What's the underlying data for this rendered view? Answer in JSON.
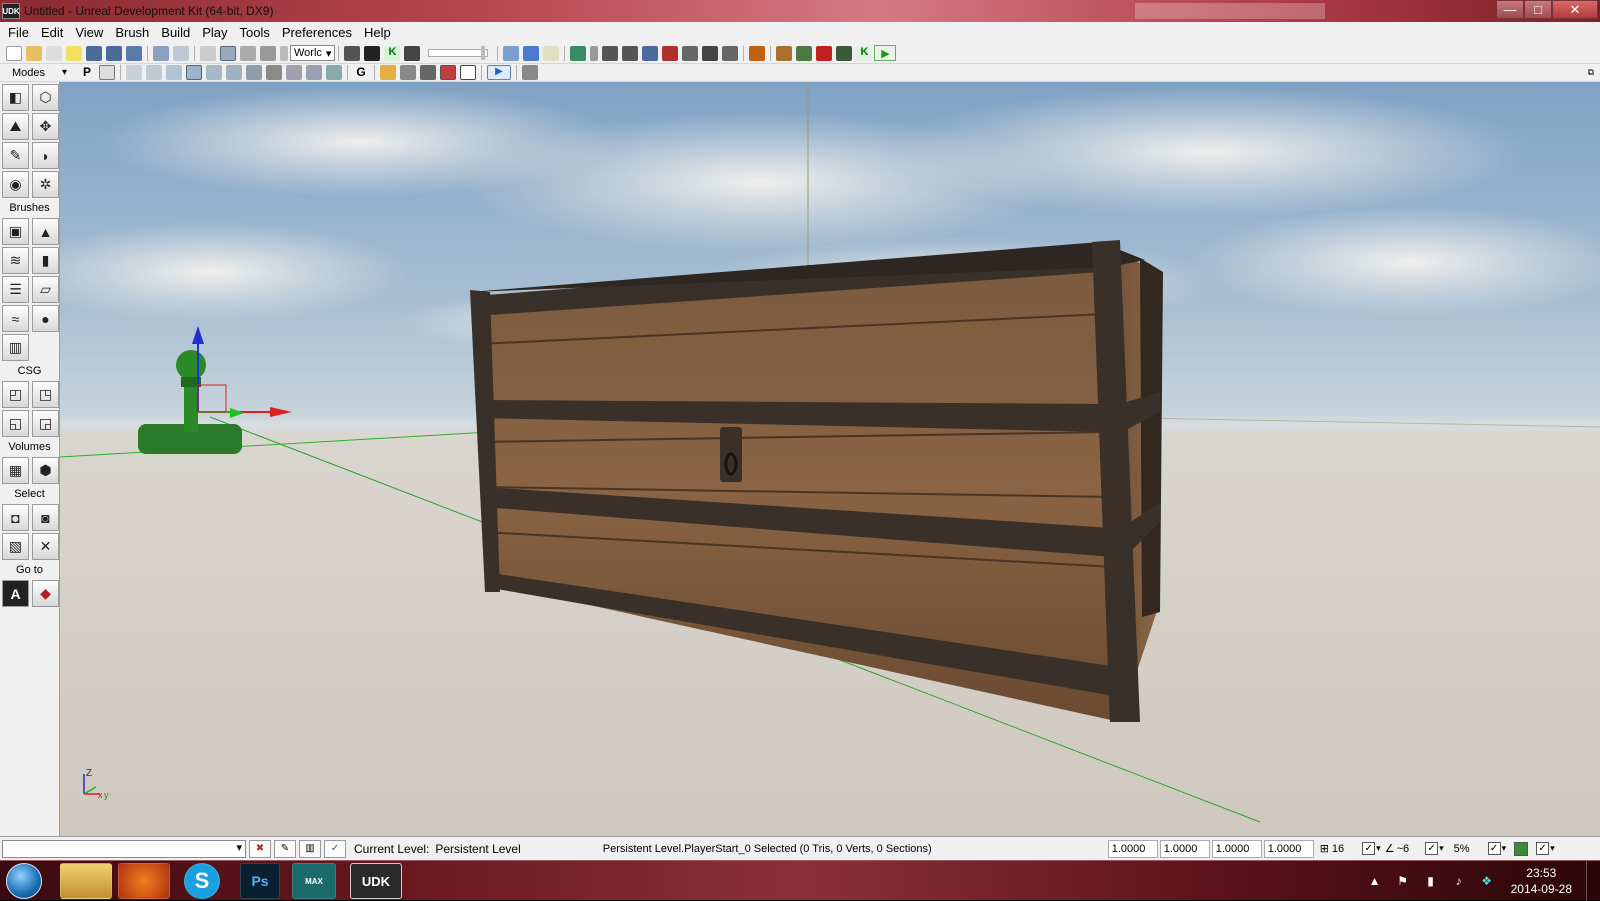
{
  "window": {
    "app_icon": "UDK",
    "title": "Untitled - Unreal Development Kit (64-bit, DX9)",
    "controls": {
      "minimize": "—",
      "maximize": "□",
      "close": "✕"
    }
  },
  "menubar": [
    "File",
    "Edit",
    "View",
    "Brush",
    "Build",
    "Play",
    "Tools",
    "Preferences",
    "Help"
  ],
  "toolbar": {
    "coordinate_system": "Worlc",
    "modes_label": "Modes",
    "p_label": "P",
    "g_label": "G",
    "k_label": "K"
  },
  "sidebar": {
    "sections": {
      "brushes": "Brushes",
      "csg": "CSG",
      "volumes": "Volumes",
      "select": "Select",
      "goto": "Go to"
    },
    "goto_actor_label": "A"
  },
  "viewport": {
    "axis_z": "Z",
    "axis_x": "x",
    "axis_y": "y"
  },
  "statusbar": {
    "current_level_label": "Current Level:",
    "current_level_value": "Persistent Level",
    "selection_info": "Persistent Level.PlayerStart_0 Selected (0 Tris, 0 Verts, 0 Sections)",
    "drag_scale": [
      "1.0000",
      "1.0000",
      "1.0000",
      "1.0000"
    ],
    "grid_size": "16",
    "rotation_snap": "~6",
    "scale_snap": "5%"
  },
  "taskbar": {
    "apps": [
      "Explorer",
      "Firefox",
      "S",
      "Ps",
      "MAX",
      "UDK"
    ],
    "time": "23:53",
    "date": "2014-09-28"
  },
  "colors": {
    "titlebar_accent": "#b8464e",
    "taskbar": "#6a1820",
    "sky": "#7fa2c4",
    "ground": "#cfc8bf",
    "chest_wood": "#7a5638",
    "chest_iron": "#3a302a",
    "axis_x": "#e02020",
    "axis_y": "#20b020",
    "axis_z": "#2030d0"
  }
}
